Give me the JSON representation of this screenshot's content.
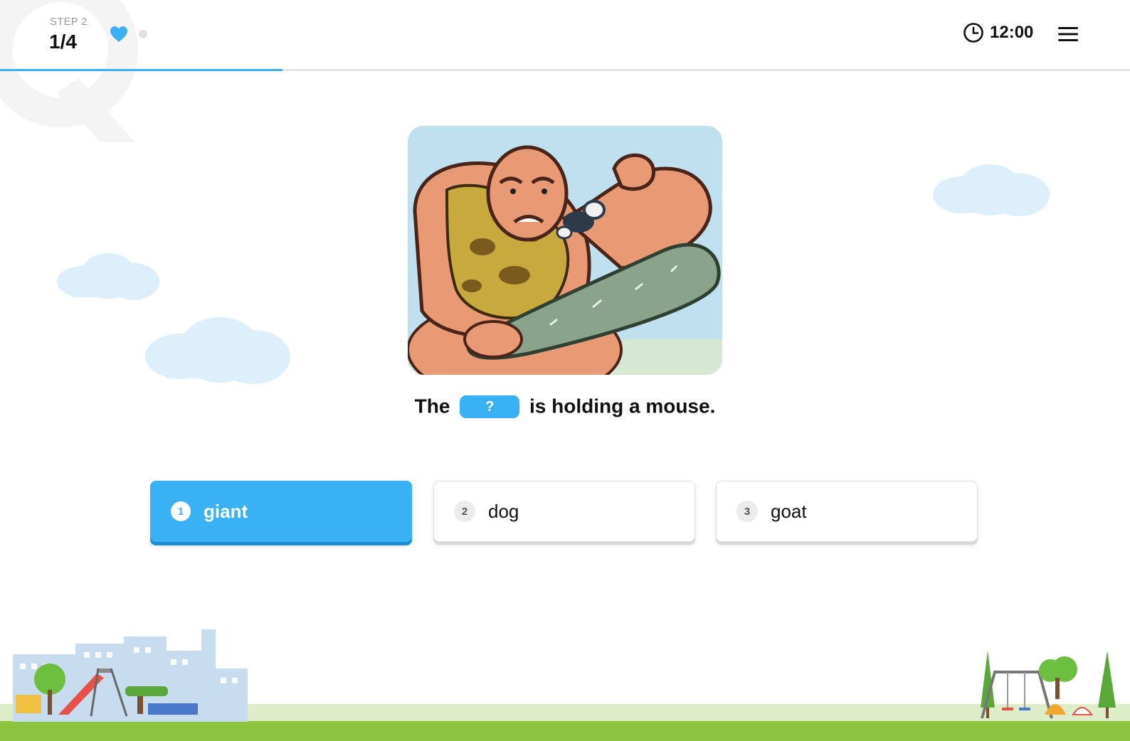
{
  "header": {
    "step_label": "STEP 2",
    "step_count": "1/4",
    "timer": "12:00",
    "progress_fraction": 0.25,
    "lives_filled": 1,
    "lives_empty": 1
  },
  "question": {
    "before": "The",
    "blank": "?",
    "after": "is holding a mouse."
  },
  "options": [
    {
      "number": "1",
      "label": "giant",
      "selected": true
    },
    {
      "number": "2",
      "label": "dog",
      "selected": false
    },
    {
      "number": "3",
      "label": "goat",
      "selected": false
    }
  ],
  "colors": {
    "accent": "#3ab1f5",
    "ground": "#8dc43f",
    "cloud": "#dceffb"
  },
  "icons": [
    "heart-icon",
    "clock-icon",
    "hamburger-menu-icon"
  ]
}
